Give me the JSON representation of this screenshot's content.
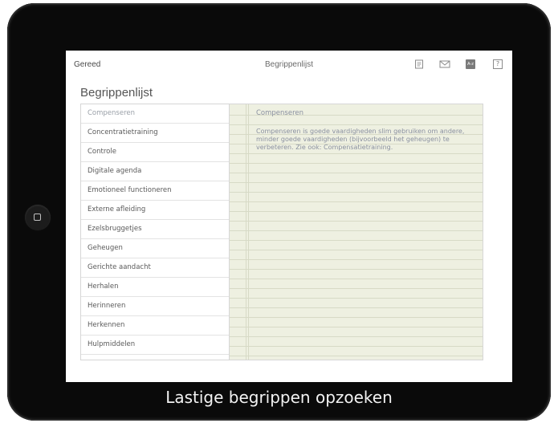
{
  "nav": {
    "left_label": "Gereed",
    "title": "Begrippenlijst",
    "icons": [
      "notes-icon",
      "mail-icon",
      "glossary-icon",
      "help-icon"
    ],
    "help_glyph": "?",
    "glossary_glyph": "A-z"
  },
  "section": {
    "title": "Begrippenlijst"
  },
  "terms": [
    "Compenseren",
    "Concentratietraining",
    "Controle",
    "Digitale agenda",
    "Emotioneel functioneren",
    "Externe afleiding",
    "Ezelsbruggetjes",
    "Geheugen",
    "Gerichte aandacht",
    "Herhalen",
    "Herinneren",
    "Herkennen",
    "Hulpmiddelen"
  ],
  "selected_term_index": 0,
  "note": {
    "title": "Compenseren",
    "body": "Compenseren is goede vaardigheden slim gebruiken om andere, minder goede vaardigheden (bijvoorbeeld het geheugen) te verbeteren. Zie ook: Compensatietraining."
  },
  "caption": "Lastige begrippen opzoeken",
  "colors": {
    "note_background": "#eef0e1",
    "note_text": "#8a90a0",
    "device_bezel": "#0a0a0a"
  }
}
